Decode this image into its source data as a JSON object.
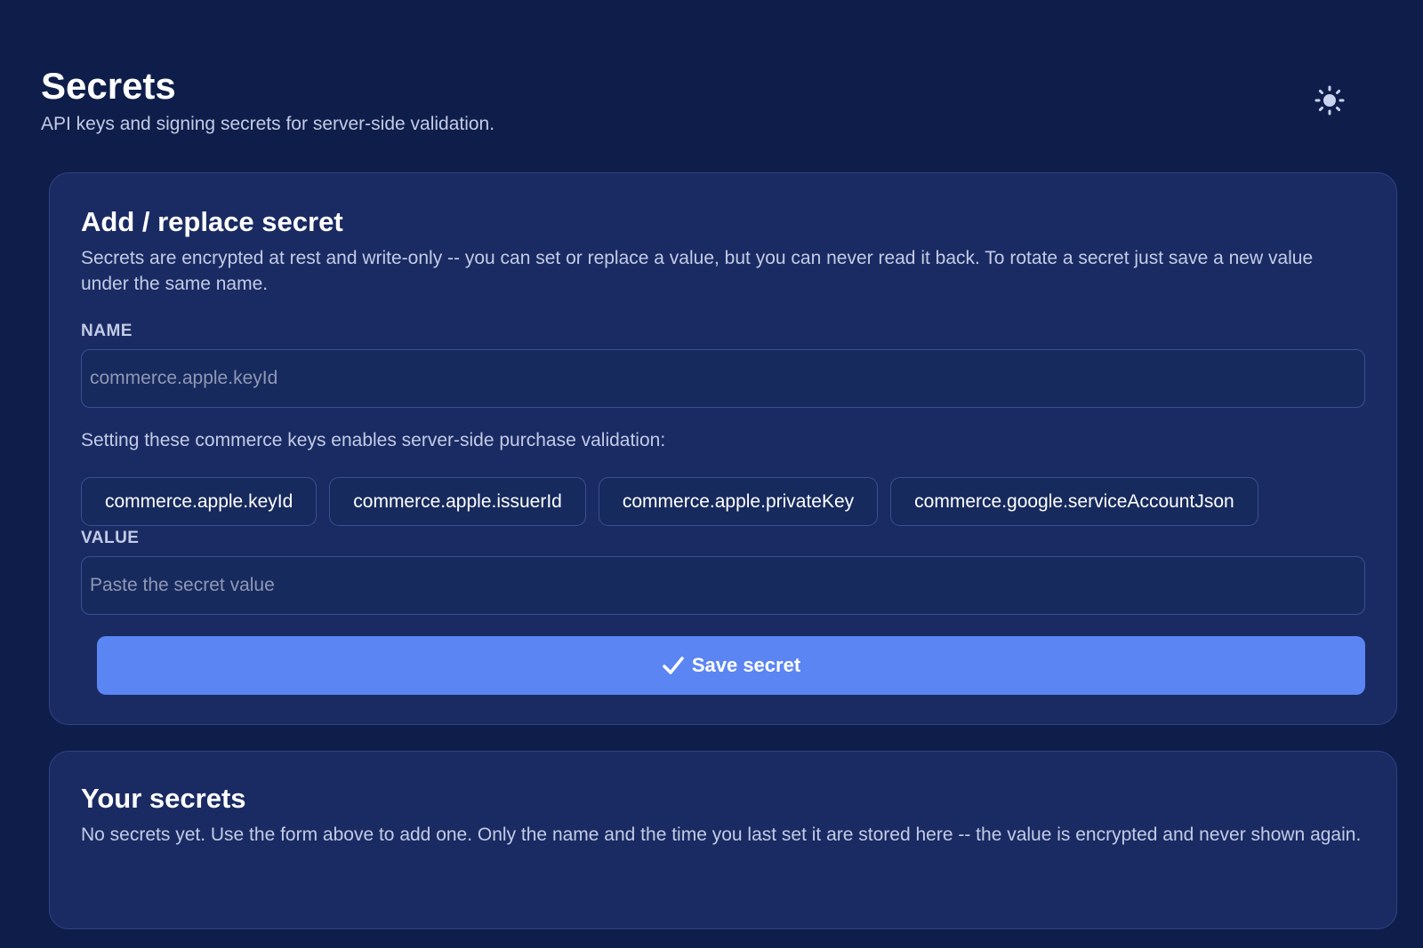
{
  "header": {
    "title": "Secrets",
    "subtitle": "API keys and signing secrets for server-side validation.",
    "theme_toggle_icon": "sun-icon"
  },
  "form": {
    "title": "Add / replace secret",
    "description": "Secrets are encrypted at rest and write-only -- you can set or replace a value, but you can never read it back. To rotate a secret just save a new value under the same name.",
    "name_label": "NAME",
    "name_placeholder": "commerce.apple.keyId",
    "name_value": "",
    "hint": "Setting these commerce keys enables server-side purchase validation:",
    "suggested_keys": [
      "commerce.apple.keyId",
      "commerce.apple.issuerId",
      "commerce.apple.privateKey",
      "commerce.google.serviceAccountJson"
    ],
    "value_label": "VALUE",
    "value_placeholder": "Paste the secret value",
    "value_value": "",
    "save_label": "Save secret",
    "save_icon": "check-icon"
  },
  "list": {
    "title": "Your secrets",
    "empty_text": "No secrets yet. Use the form above to add one. Only the name and the time you last set it are stored here -- the value is encrypted and never shown again."
  },
  "colors": {
    "background": "#0f1d4a",
    "card": "#1a2b63",
    "accent": "#5b85f2",
    "muted_text": "#c3cbe6"
  }
}
